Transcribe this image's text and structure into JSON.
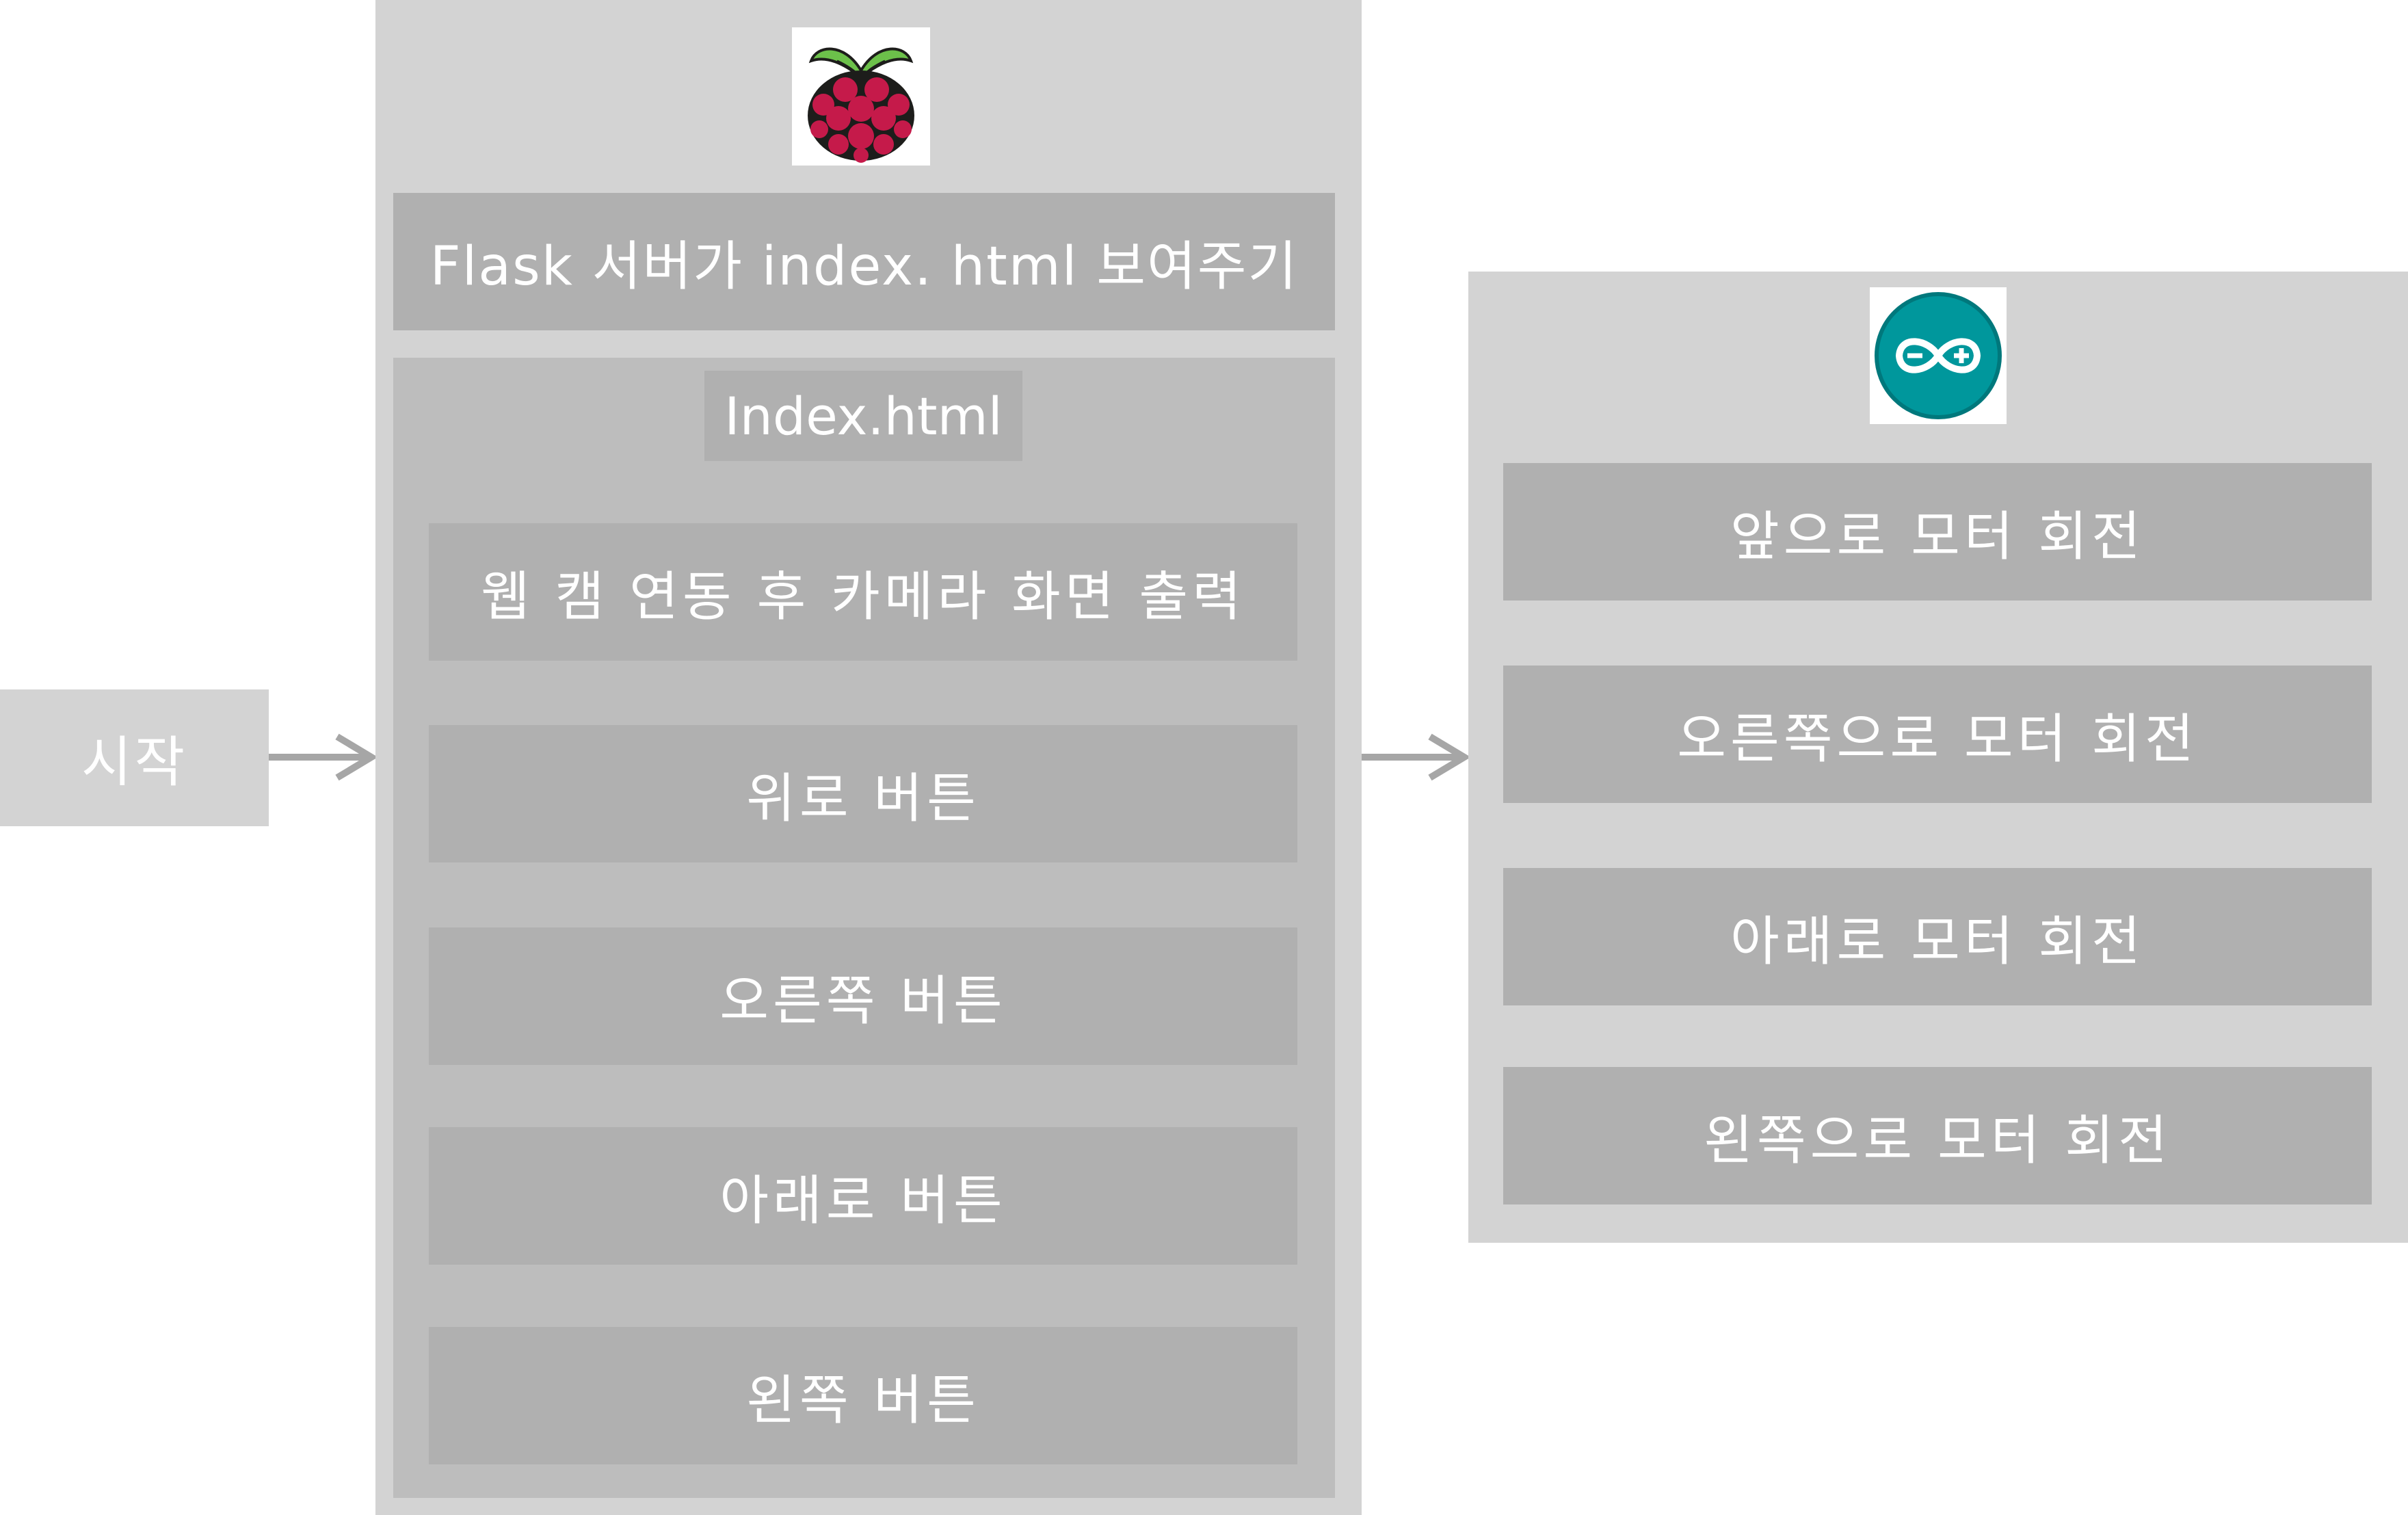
{
  "start": {
    "label": "시작"
  },
  "raspberry_pi": {
    "logo_icon": "raspberry-pi-logo",
    "flask_label": "Flask 서버가 index. html 보여주기",
    "index_panel": {
      "title": "Index.html",
      "items": [
        "웹 캠 연동 후 카메라 화면 출력",
        "위로 버튼",
        "오른쪽 버튼",
        "아래로 버튼",
        "왼쪽 버튼"
      ]
    }
  },
  "arduino": {
    "logo_icon": "arduino-logo",
    "items": [
      "앞으로 모터 회전",
      "오른쪽으로 모터 회전",
      "아래로 모터 회전",
      "왼쪽으로 모터 회전"
    ]
  },
  "colors": {
    "panel": "#d3d3d3",
    "sub_panel": "#bdbdbd",
    "item": "#b0b0b0",
    "arrow": "#a6a6a6",
    "text": "#ffffff",
    "arduino_teal": "#00979c"
  }
}
